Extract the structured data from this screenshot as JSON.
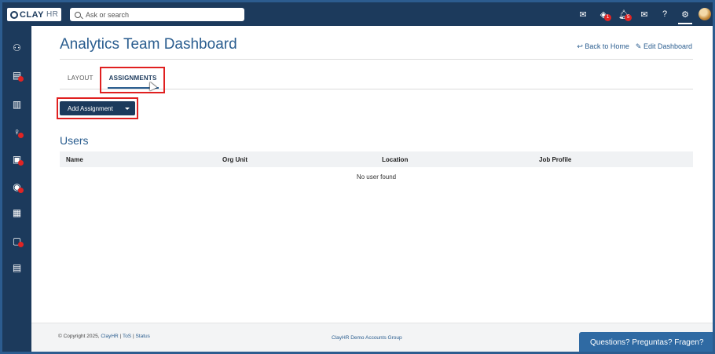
{
  "topbar": {
    "logo_brand": "CLAY",
    "logo_suffix": "HR",
    "search_placeholder": "Ask or search",
    "icons": [
      {
        "name": "messages-icon",
        "glyph": "✉",
        "badge": ""
      },
      {
        "name": "layers-icon",
        "glyph": "◈",
        "badge": "1"
      },
      {
        "name": "bell-icon",
        "glyph": "🔔︎",
        "badge": "5"
      },
      {
        "name": "mail-icon",
        "glyph": "✉",
        "badge": ""
      },
      {
        "name": "help-icon",
        "glyph": "?",
        "badge": ""
      },
      {
        "name": "settings-icon",
        "glyph": "⚙",
        "badge": ""
      }
    ]
  },
  "sidebar": {
    "items": [
      {
        "name": "people-icon",
        "glyph": "⚇",
        "dot": false
      },
      {
        "name": "id-card-icon",
        "glyph": "▤",
        "dot": true
      },
      {
        "name": "chart-icon",
        "glyph": "▥",
        "dot": false
      },
      {
        "name": "lightbulb-icon",
        "glyph": "♀",
        "dot": true
      },
      {
        "name": "documents-icon",
        "glyph": "▣",
        "dot": true
      },
      {
        "name": "dollar-icon",
        "glyph": "◉",
        "dot": true
      },
      {
        "name": "report-icon",
        "glyph": "▦",
        "dot": false
      },
      {
        "name": "screen-icon",
        "glyph": "▢",
        "dot": true
      },
      {
        "name": "clipboard-icon",
        "glyph": "▤",
        "dot": false
      }
    ]
  },
  "page": {
    "title": "Analytics Team Dashboard",
    "back_home": "↩ Back to Home",
    "edit_dashboard": "✎ Edit Dashboard",
    "tabs": [
      {
        "label": "LAYOUT",
        "active": false
      },
      {
        "label": "ASSIGNMENTS",
        "active": true
      }
    ],
    "add_button": "Add Assignment",
    "section_title": "Users",
    "columns": [
      "Name",
      "Org Unit",
      "Location",
      "Job Profile"
    ],
    "empty_message": "No user found"
  },
  "footer": {
    "copyright": "© Copyright 2025,",
    "link_clayhr": "ClayHR",
    "sep1": "|",
    "link_tos": "ToS",
    "sep2": "|",
    "link_status": "Status",
    "center": "ClayHR Demo Accounts Group",
    "help": "Questions? Preguntas? Fragen?"
  },
  "colors": {
    "nav": "#1c3a5c",
    "accent": "#2a5d8f",
    "highlight": "#e02020",
    "badge": "#e02424"
  }
}
